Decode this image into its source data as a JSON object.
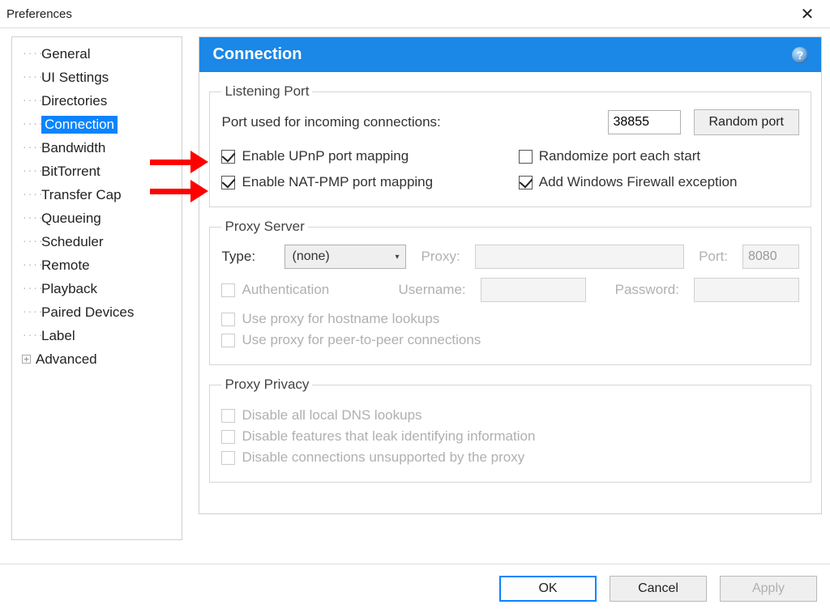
{
  "window": {
    "title": "Preferences"
  },
  "sidebar": {
    "items": [
      {
        "label": "General"
      },
      {
        "label": "UI Settings"
      },
      {
        "label": "Directories"
      },
      {
        "label": "Connection",
        "selected": true
      },
      {
        "label": "Bandwidth"
      },
      {
        "label": "BitTorrent"
      },
      {
        "label": "Transfer Cap"
      },
      {
        "label": "Queueing"
      },
      {
        "label": "Scheduler"
      },
      {
        "label": "Remote"
      },
      {
        "label": "Playback"
      },
      {
        "label": "Paired Devices"
      },
      {
        "label": "Label"
      },
      {
        "label": "Advanced",
        "expandable": true
      }
    ]
  },
  "panel": {
    "title": "Connection",
    "listening": {
      "legend": "Listening Port",
      "port_label": "Port used for incoming connections:",
      "port_value": "38855",
      "random_btn": "Random port",
      "upnp": "Enable UPnP port mapping",
      "randomize": "Randomize port each start",
      "natpmp": "Enable NAT-PMP port mapping",
      "firewall": "Add Windows Firewall exception"
    },
    "proxy": {
      "legend": "Proxy Server",
      "type_label": "Type:",
      "type_value": "(none)",
      "proxy_label": "Proxy:",
      "port_label": "Port:",
      "port_value": "8080",
      "auth": "Authentication",
      "user_label": "Username:",
      "pass_label": "Password:",
      "hostname": "Use proxy for hostname lookups",
      "p2p": "Use proxy for peer-to-peer connections"
    },
    "privacy": {
      "legend": "Proxy Privacy",
      "dns": "Disable all local DNS lookups",
      "leak": "Disable features that leak identifying information",
      "unsupported": "Disable connections unsupported by the proxy"
    }
  },
  "footer": {
    "ok": "OK",
    "cancel": "Cancel",
    "apply": "Apply"
  }
}
